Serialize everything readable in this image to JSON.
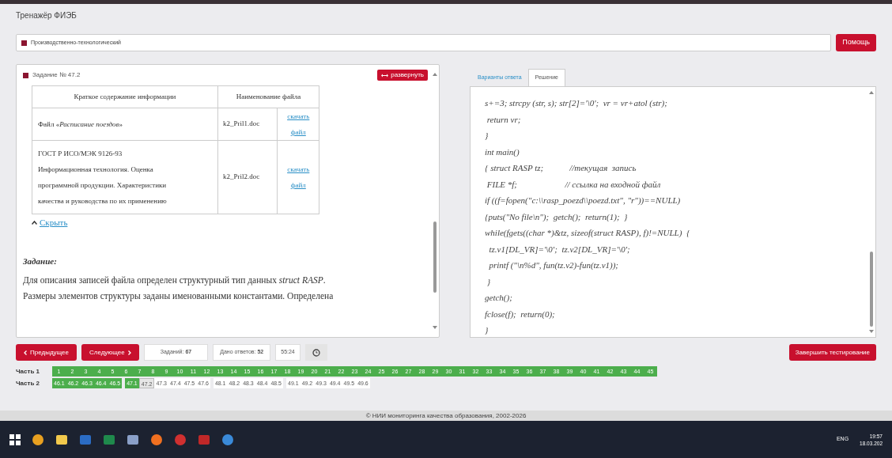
{
  "app_title": "Тренажёр ФИЭБ",
  "section": {
    "label": "Производственно-технологический"
  },
  "help_button": "Помощь",
  "task": {
    "title": "Задание № 47.2",
    "expand_button": "развернуть",
    "table": {
      "columns": [
        "Краткое содержание информации",
        "Наименование файла"
      ],
      "rows": [
        {
          "content": [
            "Файл «*Расписание поездов*»"
          ],
          "file": "k2_Pril1.doc",
          "link": [
            "скачать",
            "файл"
          ]
        },
        {
          "content": [
            "ГОСТ Р ИСО/МЭК 9126-93",
            "Информационная технология. Оценка",
            "программной продукции. Характеристики",
            "качества и руководства по их применению"
          ],
          "file": "k2_Pril2.doc",
          "link": [
            "скачать",
            "файл"
          ]
        }
      ]
    },
    "hide_link": "Скрыть",
    "heading": "Задание:",
    "text": [
      "Для описания записей файла определен структурный тип данных *struct RASP*.",
      "Размеры элементов структуры заданы именованными константами. Определена"
    ]
  },
  "tabs": [
    {
      "label": "Варианты ответа",
      "selected": false
    },
    {
      "label": "Решение",
      "selected": true
    }
  ],
  "code": [
    "s+=3; strcpy (str, s); str[2]='\\0';  vr = vr+atol (str);",
    " return vr;",
    "}",
    "int main()",
    "{ struct RASP tz;            //текущая  запись",
    " FILE *f;                      // ссылка на входной файл",
    "if ((f=fopen(\"c:\\\\rasp_poezd\\\\poezd.txt\", \"r\"))==NULL)",
    "{puts(\"No file\\n\");  getch();  return(1);  }",
    "while(fgets((char *)&tz, sizeof(struct RASP), f)!=NULL)  {",
    "  tz.v1[DL_VR]='\\0';  tz.v2[DL_VR]='\\0';",
    "  printf (\"\\n%d\", fun(tz.v2)-fun(tz.v1));",
    " }",
    "getch();",
    "fclose(f);  return(0);",
    "}"
  ],
  "nav": {
    "prev": "Предыдущее",
    "next": "Следующее",
    "tasks": "Заданий: **67**",
    "answered": "Дано ответов: **52**",
    "timer": "55:24",
    "finish": "Завершить тестирование"
  },
  "parts": [
    {
      "label": "Часть 1",
      "groups": [
        [
          {
            "n": "1",
            "answered": true,
            "selected": false
          },
          {
            "n": "2",
            "answered": true,
            "selected": false
          },
          {
            "n": "3",
            "answered": true,
            "selected": false
          },
          {
            "n": "4",
            "answered": true,
            "selected": false
          },
          {
            "n": "5",
            "answered": true,
            "selected": false
          },
          {
            "n": "6",
            "answered": true,
            "selected": false
          },
          {
            "n": "7",
            "answered": true,
            "selected": false
          },
          {
            "n": "8",
            "answered": true,
            "selected": false
          },
          {
            "n": "9",
            "answered": true,
            "selected": false
          },
          {
            "n": "10",
            "answered": true,
            "selected": false
          },
          {
            "n": "11",
            "answered": true,
            "selected": false
          },
          {
            "n": "12",
            "answered": true,
            "selected": false
          },
          {
            "n": "13",
            "answered": true,
            "selected": false
          },
          {
            "n": "14",
            "answered": true,
            "selected": false
          },
          {
            "n": "15",
            "answered": true,
            "selected": false
          },
          {
            "n": "16",
            "answered": true,
            "selected": false
          },
          {
            "n": "17",
            "answered": true,
            "selected": false
          },
          {
            "n": "18",
            "answered": true,
            "selected": false
          },
          {
            "n": "19",
            "answered": true,
            "selected": false
          },
          {
            "n": "20",
            "answered": true,
            "selected": false
          },
          {
            "n": "21",
            "answered": true,
            "selected": false
          },
          {
            "n": "22",
            "answered": true,
            "selected": false
          },
          {
            "n": "23",
            "answered": true,
            "selected": false
          },
          {
            "n": "24",
            "answered": true,
            "selected": false
          },
          {
            "n": "25",
            "answered": true,
            "selected": false
          },
          {
            "n": "26",
            "answered": true,
            "selected": false
          },
          {
            "n": "27",
            "answered": true,
            "selected": false
          },
          {
            "n": "28",
            "answered": true,
            "selected": false
          },
          {
            "n": "29",
            "answered": true,
            "selected": false
          },
          {
            "n": "30",
            "answered": true,
            "selected": false
          },
          {
            "n": "31",
            "answered": true,
            "selected": false
          },
          {
            "n": "32",
            "answered": true,
            "selected": false
          },
          {
            "n": "33",
            "answered": true,
            "selected": false
          },
          {
            "n": "34",
            "answered": true,
            "selected": false
          },
          {
            "n": "35",
            "answered": true,
            "selected": false
          },
          {
            "n": "36",
            "answered": true,
            "selected": false
          },
          {
            "n": "37",
            "answered": true,
            "selected": false
          },
          {
            "n": "38",
            "answered": true,
            "selected": false
          },
          {
            "n": "39",
            "answered": true,
            "selected": false
          },
          {
            "n": "40",
            "answered": true,
            "selected": false
          },
          {
            "n": "41",
            "answered": true,
            "selected": false
          },
          {
            "n": "42",
            "answered": true,
            "selected": false
          },
          {
            "n": "43",
            "answered": true,
            "selected": false
          },
          {
            "n": "44",
            "answered": true,
            "selected": false
          },
          {
            "n": "45",
            "answered": true,
            "selected": false
          }
        ]
      ]
    },
    {
      "label": "Часть 2",
      "groups": [
        [
          {
            "n": "46.1",
            "answered": true,
            "selected": false
          },
          {
            "n": "46.2",
            "answered": true,
            "selected": false
          },
          {
            "n": "46.3",
            "answered": true,
            "selected": false
          },
          {
            "n": "46.4",
            "answered": true,
            "selected": false
          },
          {
            "n": "46.5",
            "answered": true,
            "selected": false
          }
        ],
        [
          {
            "n": "47.1",
            "answered": true,
            "selected": false
          },
          {
            "n": "47.2",
            "answered": false,
            "selected": true
          },
          {
            "n": "47.3",
            "answered": false,
            "selected": false
          },
          {
            "n": "47.4",
            "answered": false,
            "selected": false
          },
          {
            "n": "47.5",
            "answered": false,
            "selected": false
          },
          {
            "n": "47.6",
            "answered": false,
            "selected": false
          }
        ],
        [
          {
            "n": "48.1",
            "answered": false,
            "selected": false
          },
          {
            "n": "48.2",
            "answered": false,
            "selected": false
          },
          {
            "n": "48.3",
            "answered": false,
            "selected": false
          },
          {
            "n": "48.4",
            "answered": false,
            "selected": false
          },
          {
            "n": "48.5",
            "answered": false,
            "selected": false
          }
        ],
        [
          {
            "n": "49.1",
            "answered": false,
            "selected": false
          },
          {
            "n": "49.2",
            "answered": false,
            "selected": false
          },
          {
            "n": "49.3",
            "answered": false,
            "selected": false
          },
          {
            "n": "49.4",
            "answered": false,
            "selected": false
          },
          {
            "n": "49.5",
            "answered": false,
            "selected": false
          },
          {
            "n": "49.6",
            "answered": false,
            "selected": false
          }
        ]
      ]
    }
  ],
  "footer": "© НИИ мониторинга качества образования, 2002-2026",
  "taskbar": {
    "language": "ENG",
    "time": "19:57",
    "date": "18.03.202"
  }
}
